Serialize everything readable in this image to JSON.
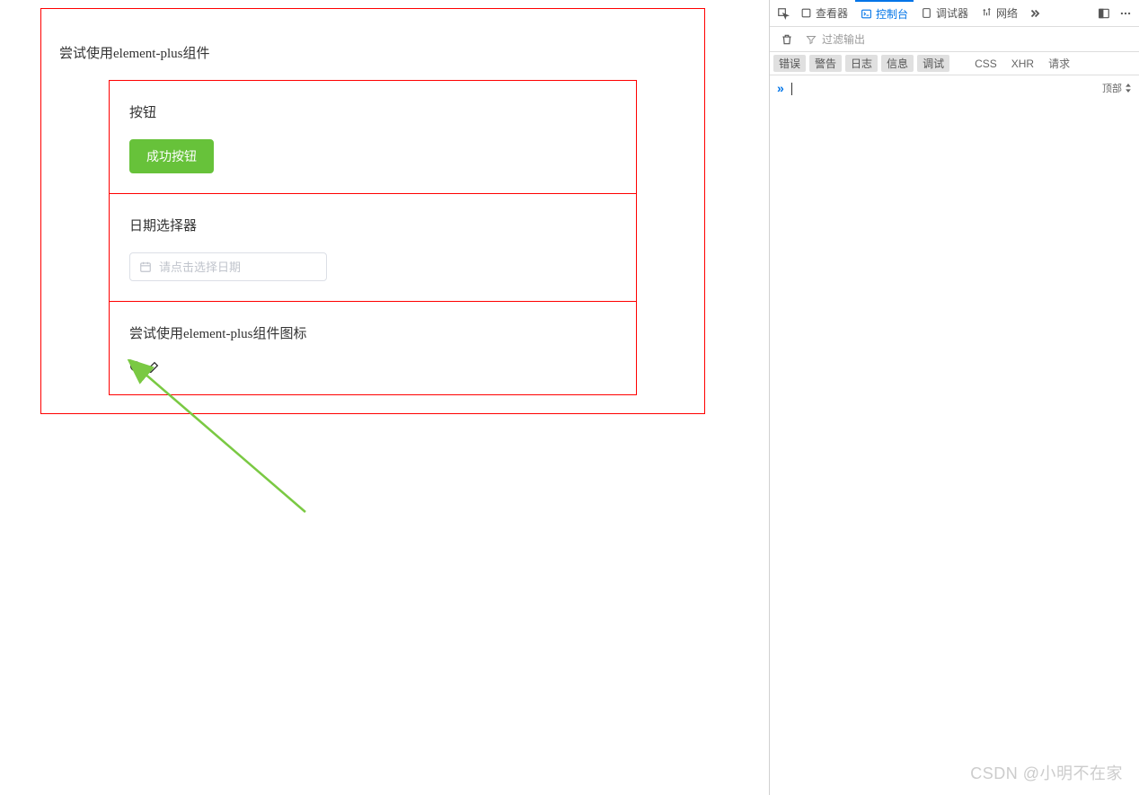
{
  "page": {
    "title": "尝试使用element-plus组件",
    "sections": {
      "button": {
        "heading": "按钮",
        "success_label": "成功按钮"
      },
      "datepicker": {
        "heading": "日期选择器",
        "placeholder": "请点击选择日期"
      },
      "icons": {
        "heading": "尝试使用element-plus组件图标"
      }
    }
  },
  "devtools": {
    "tabs": {
      "inspector": "查看器",
      "console": "控制台",
      "debugger": "调试器",
      "network": "网络"
    },
    "filter_placeholder": "过滤输出",
    "levels": {
      "error": "错误",
      "warn": "警告",
      "log": "日志",
      "info": "信息",
      "debug": "调试",
      "css": "CSS",
      "xhr": "XHR",
      "requests": "请求"
    },
    "context_label": "顶部"
  },
  "watermark": "CSDN @小明不在家",
  "colors": {
    "border_red": "#ff0000",
    "success_green": "#67c23a",
    "devtools_blue": "#0074e8",
    "arrow_green": "#7ac943"
  }
}
